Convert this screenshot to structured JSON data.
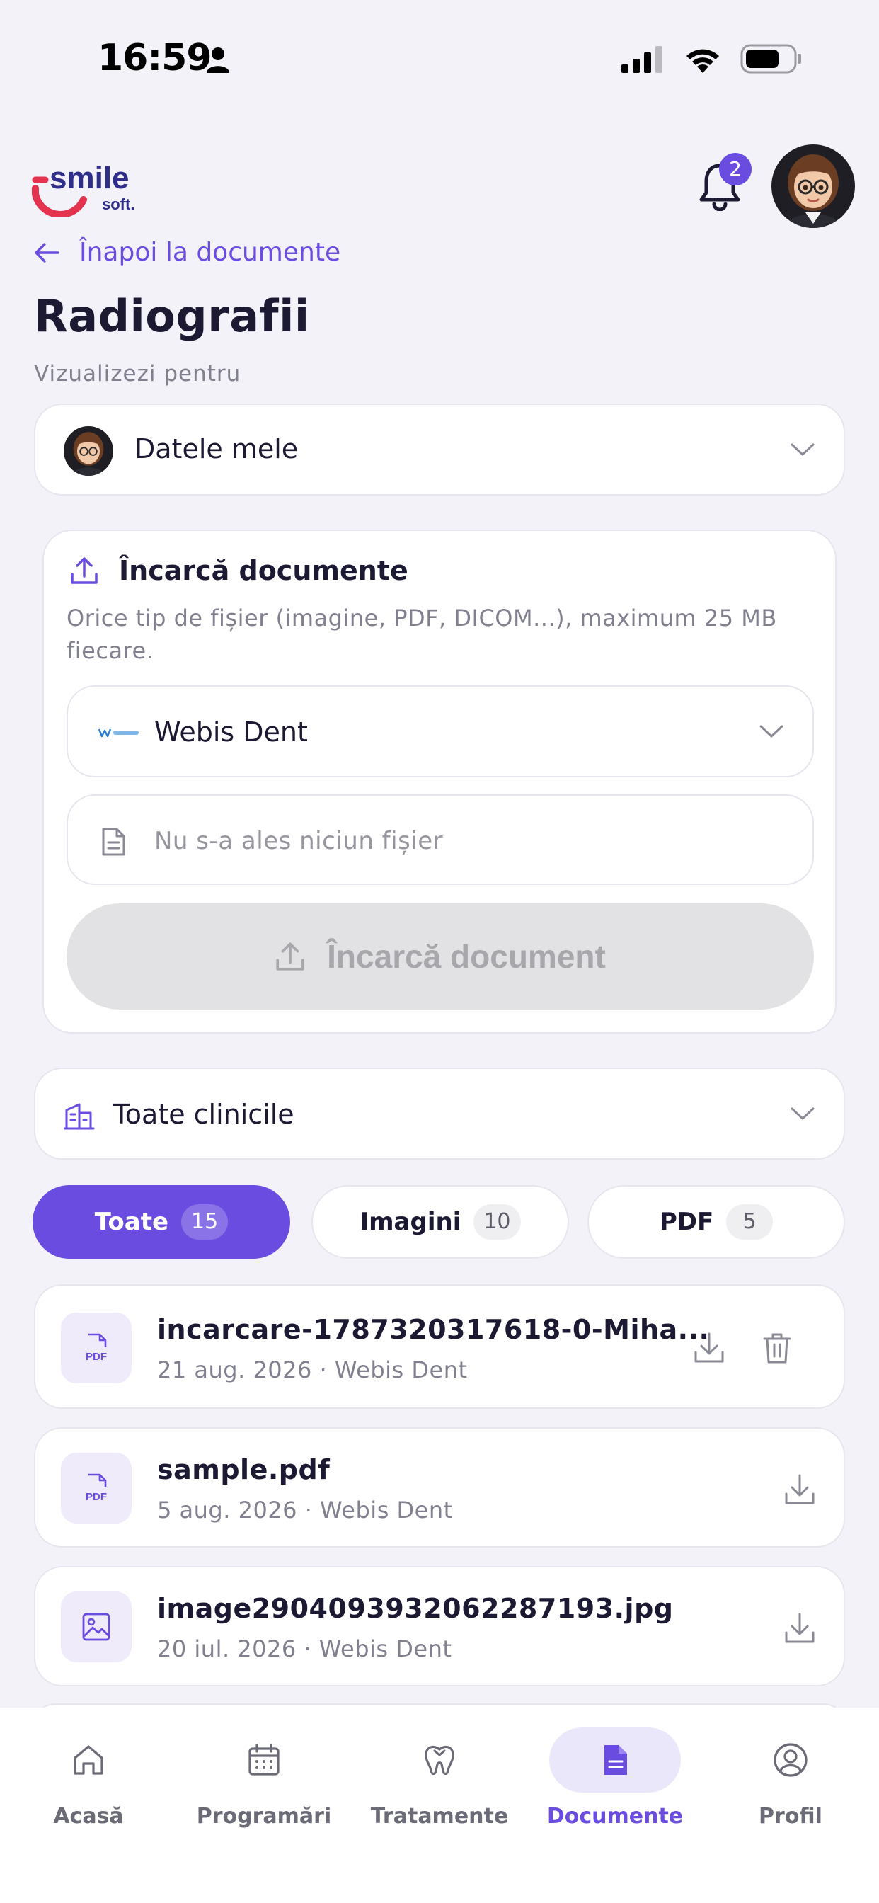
{
  "status_bar": {
    "time": "16:59"
  },
  "header": {
    "logo_text": "smile",
    "logo_sub": "soft.",
    "notification_count": "2"
  },
  "back_link": {
    "label": "Înapoi la documente"
  },
  "page": {
    "title": "Radiografii",
    "subtitle": "Vizualizezi pentru"
  },
  "patient_select": {
    "value": "Datele mele"
  },
  "upload": {
    "title": "Încarcă documente",
    "description": "Orice tip de fișier (imagine, PDF, DICOM...), maximum 25 MB fiecare.",
    "clinic": "Webis Dent",
    "file_placeholder": "Nu s-a ales niciun fișier",
    "button_label": "Încarcă document"
  },
  "clinics_filter": {
    "value": "Toate clinicile"
  },
  "tabs": [
    {
      "label": "Toate",
      "count": "15",
      "active": true
    },
    {
      "label": "Imagini",
      "count": "10",
      "active": false
    },
    {
      "label": "PDF",
      "count": "5",
      "active": false
    }
  ],
  "documents": [
    {
      "name": "incarcare-1787320317618-0-Miha...",
      "date": "21 aug. 2026",
      "clinic": "Webis Dent",
      "meta": "21 aug. 2026 · Webis Dent",
      "type": "PDF",
      "deletable": true
    },
    {
      "name": "sample.pdf",
      "date": "5 aug. 2026",
      "clinic": "Webis Dent",
      "meta": "5 aug. 2026 · Webis Dent",
      "type": "PDF",
      "deletable": false
    },
    {
      "name": "image2904093932062287193.jpg",
      "date": "20 iul. 2026",
      "clinic": "Webis Dent",
      "meta": "20 iul. 2026 · Webis Dent",
      "type": "image",
      "deletable": false
    }
  ],
  "bottom_nav": [
    {
      "label": "Acasă",
      "icon": "home-icon",
      "active": false
    },
    {
      "label": "Programări",
      "icon": "calendar-icon",
      "active": false
    },
    {
      "label": "Tratamente",
      "icon": "tooth-icon",
      "active": false
    },
    {
      "label": "Documente",
      "icon": "document-icon",
      "active": true
    },
    {
      "label": "Profil",
      "icon": "profile-icon",
      "active": false
    }
  ],
  "colors": {
    "accent": "#6a4ce0",
    "background": "#f2f2f8",
    "logo_red": "#e3334f",
    "logo_blue": "#2f2e8b"
  }
}
